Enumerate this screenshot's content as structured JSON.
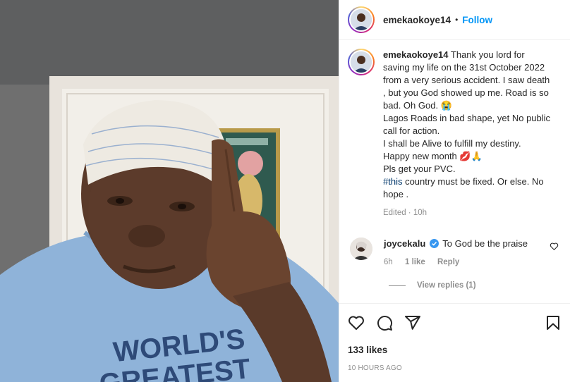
{
  "post": {
    "username": "emekaokoye14",
    "dot": "•",
    "follow_label": "Follow"
  },
  "caption": {
    "username": "emekaokoye14",
    "lines": [
      "Thank you lord for saving my life on the 31st October 2022 from a very serious accident. I saw death , but you God showed up me. Road is so bad. Oh God. 😭",
      "Lagos Roads in bad shape, yet No public call for action.",
      "I shall be Alive to fulfill my destiny.",
      "Happy new month 💋🙏",
      "Pls get your PVC."
    ],
    "hashtag": "#this",
    "hashtag_rest": " country must be fixed. Or else. No hope .",
    "meta": "Edited · 10h"
  },
  "comment": {
    "username": "joycekalu",
    "text": "To God be the praise",
    "time": "6h",
    "likes": "1 like",
    "reply": "Reply",
    "view_replies": "View replies (1)"
  },
  "footer": {
    "likes": "133 likes",
    "time": "10 HOURS AGO"
  },
  "icons": {
    "like": "heart-icon",
    "comment": "comment-icon",
    "share": "share-icon",
    "save": "bookmark-icon",
    "verified": "verified-badge-icon"
  },
  "colors": {
    "follow": "#0095f6",
    "verified": "#3897f0",
    "shirt": "#8fb3d9",
    "shirt_print": "#2e4a78"
  },
  "photo": {
    "shirt_text_line1": "WORLD'S",
    "shirt_text_line2": "GREATEST"
  }
}
